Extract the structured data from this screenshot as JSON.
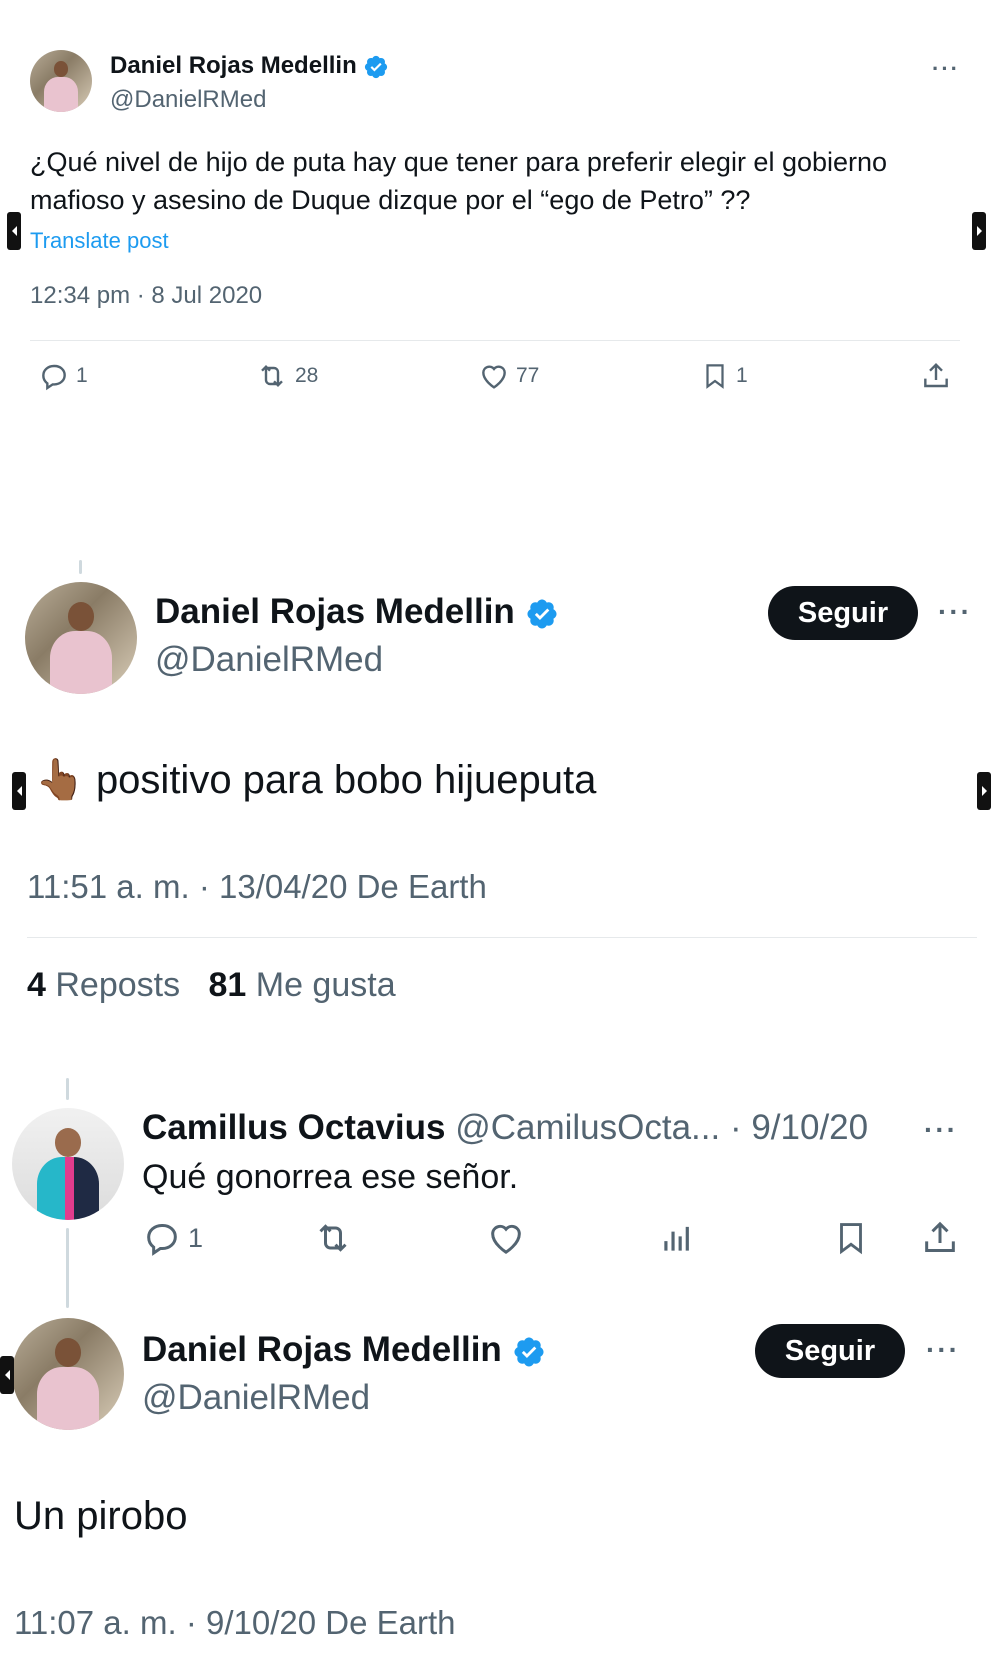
{
  "tweet1": {
    "name": "Daniel Rojas Medellin",
    "handle": "@DanielRMed",
    "text_line1": "¿Qué nivel de hijo de puta hay que tener para preferir elegir el gobierno",
    "text_line2": "mafioso y asesino de Duque dizque por el “ego de Petro” ??",
    "translate": "Translate post",
    "timestamp": "12:34 pm · 8 Jul 2020",
    "replies": "1",
    "reposts": "28",
    "likes": "77",
    "bookmarks": "1",
    "icons": [
      "reply-icon",
      "repost-icon",
      "like-icon",
      "bookmark-icon",
      "share-icon"
    ]
  },
  "tweet2": {
    "name": "Daniel Rojas Medellin",
    "handle": "@DanielRMed",
    "follow": "Seguir",
    "emoji": "👆🏾",
    "text": "positivo para bobo hijueputa",
    "timestamp": "11:51 a. m. · 13/04/20 De Earth",
    "reposts_count": "4",
    "reposts_label": "Reposts",
    "likes_count": "81",
    "likes_label": "Me gusta"
  },
  "reply": {
    "name": "Camillus Octavius",
    "handle_date": "@CamilusOcta... · 9/10/20",
    "text": "Qué gonorrea ese señor.",
    "replies": "1",
    "icons": [
      "reply-icon",
      "repost-icon",
      "like-icon",
      "views-icon",
      "bookmark-icon",
      "share-icon"
    ]
  },
  "tweet3": {
    "name": "Daniel Rojas Medellin",
    "handle": "@DanielRMed",
    "follow": "Seguir",
    "text": "Un pirobo",
    "timestamp": "11:07 a. m. · 9/10/20 De Earth"
  },
  "colors": {
    "verified": "#1d9bf0",
    "link": "#1d9bf0",
    "muted": "#536471",
    "text": "#0f1419"
  }
}
